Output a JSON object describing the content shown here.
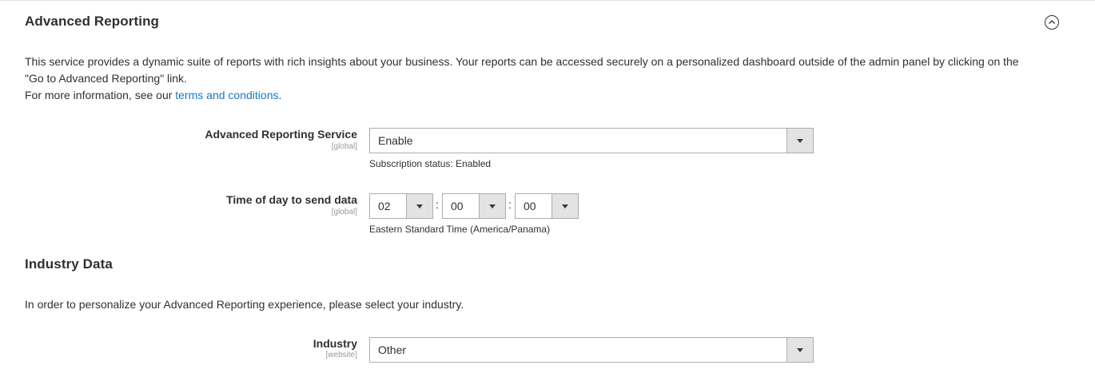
{
  "advanced_reporting": {
    "title": "Advanced Reporting",
    "description_line1": "This service provides a dynamic suite of reports with rich insights about your business. Your reports can be accessed securely on a personalized dashboard outside of the admin panel by clicking on the",
    "description_line2": "\"Go to Advanced Reporting\" link.",
    "more_info_prefix": "For more information, see our ",
    "terms_link": "terms and conditions",
    "more_info_suffix": ".",
    "service_field": {
      "label": "Advanced Reporting Service",
      "scope": "[global]",
      "value": "Enable",
      "note": "Subscription status: Enabled"
    },
    "time_field": {
      "label": "Time of day to send data",
      "scope": "[global]",
      "hour": "02",
      "minute": "00",
      "second": "00",
      "separator": ":",
      "note": "Eastern Standard Time (America/Panama)"
    }
  },
  "industry_data": {
    "title": "Industry Data",
    "description": "In order to personalize your Advanced Reporting experience, please select your industry.",
    "industry_field": {
      "label": "Industry",
      "scope": "[website]",
      "value": "Other"
    }
  },
  "icons": {
    "collapse": "chevron-up-circle-icon",
    "dropdown": "triangle-down-icon"
  },
  "colors": {
    "link": "#1979c3",
    "text": "#303030",
    "scope_text": "#999999",
    "select_border": "#adadad",
    "select_button_bg": "#e3e3e3"
  }
}
